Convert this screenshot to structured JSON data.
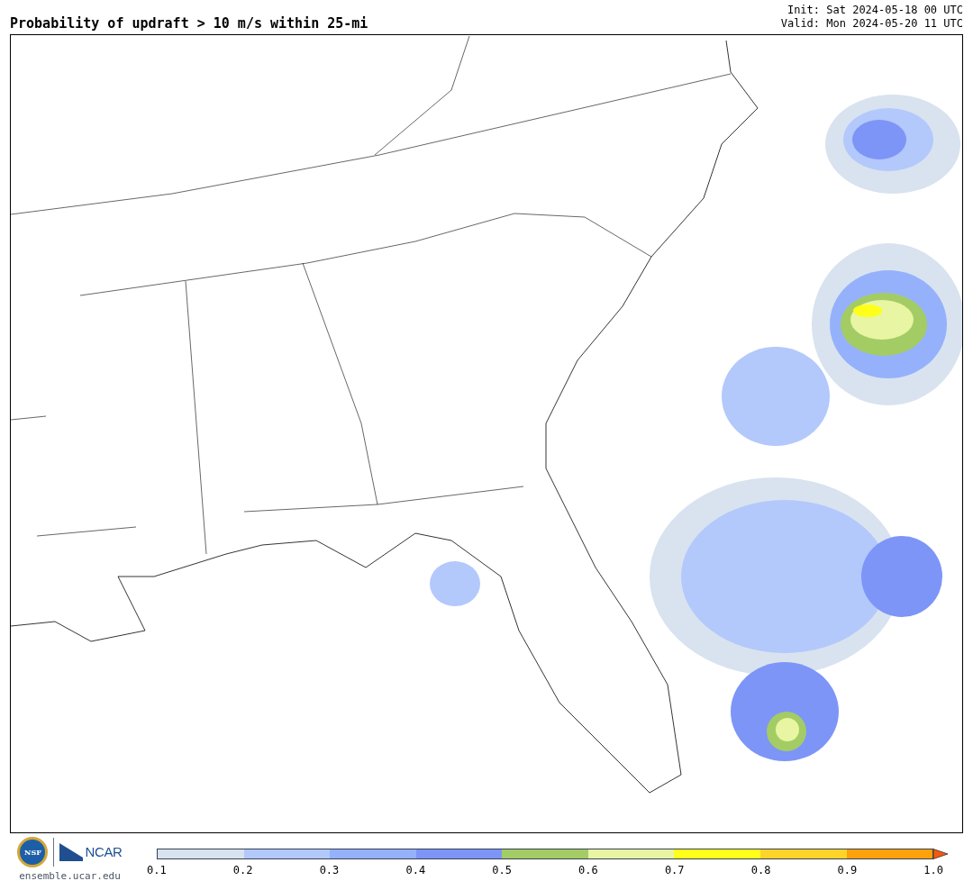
{
  "title": "Probability of updraft > 10 m/s within 25-mi",
  "init": "Init: Sat 2024-05-18 00 UTC",
  "valid": "Valid: Mon 2024-05-20 11 UTC",
  "footer": {
    "nsf_logo": "NSF",
    "ncar_logo": "NCAR",
    "site": "ensemble.ucar.edu"
  },
  "colorbar": {
    "segments": [
      {
        "kind": "band",
        "color": "#d8e3ef"
      },
      {
        "kind": "band",
        "color": "#b3c8fb"
      },
      {
        "kind": "band",
        "color": "#95b1fb"
      },
      {
        "kind": "band",
        "color": "#7d95f7"
      },
      {
        "kind": "band",
        "color": "#a4cc64"
      },
      {
        "kind": "band",
        "color": "#e8f5a3"
      },
      {
        "kind": "band",
        "color": "#ffff1a"
      },
      {
        "kind": "band",
        "color": "#ffd42a"
      },
      {
        "kind": "band",
        "color": "#ffa20a"
      },
      {
        "kind": "extend",
        "color": "#f55a0a"
      }
    ],
    "ticks": [
      "0.1",
      "0.2",
      "0.3",
      "0.4",
      "0.5",
      "0.6",
      "0.7",
      "0.8",
      "0.9",
      "1.0"
    ]
  }
}
